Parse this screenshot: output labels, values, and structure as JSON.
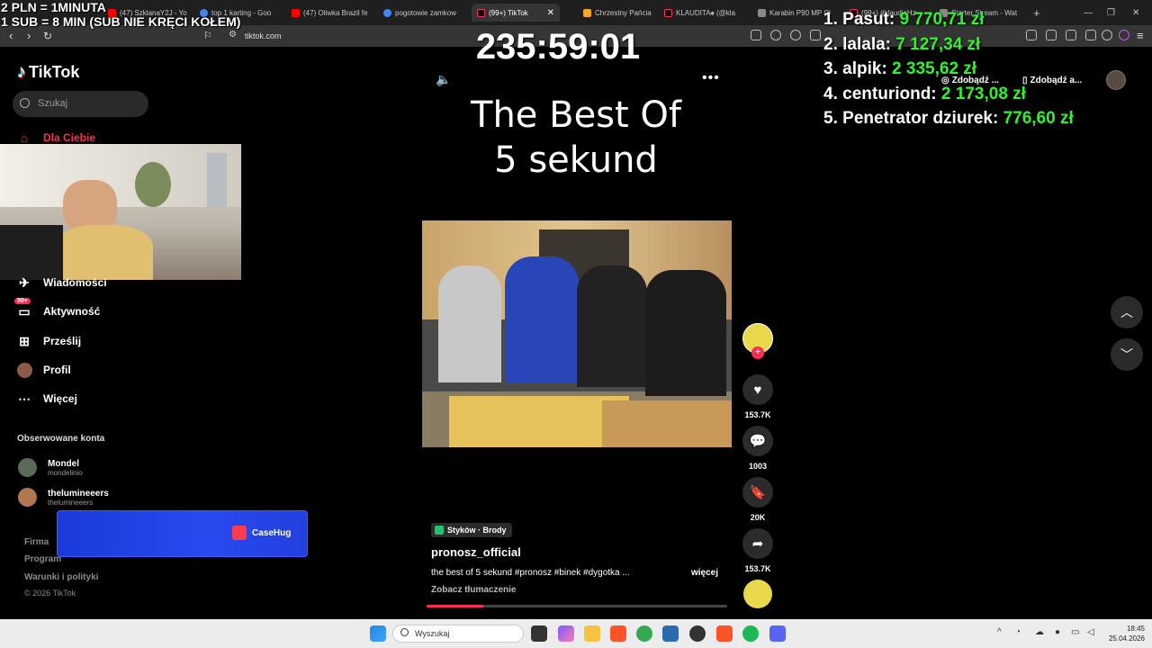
{
  "browser": {
    "tabs": [
      {
        "label": "(47) SzklanaY2J - Yo",
        "color": "#ff0000"
      },
      {
        "label": "top 1 karting - Goo",
        "color": "#4285f4"
      },
      {
        "label": "(47) Oliwka Brazil fe",
        "color": "#ff0000"
      },
      {
        "label": "pogotowie zamkow",
        "color": "#4285f4"
      },
      {
        "label": "(99+) TikTok",
        "color": "#fe2c55",
        "active": true
      },
      {
        "label": "Chrzestny Pańcia",
        "color": "#f5a623"
      },
      {
        "label": "KLAUDITA♠ (@kla",
        "color": "#fe2c55"
      },
      {
        "label": "Karabin P90 MP Ci",
        "color": "#888888"
      },
      {
        "label": "(99+) #klaudiaHz",
        "color": "#fe2c55"
      },
      {
        "label": "Starter Stream - Wat",
        "color": "#888888"
      }
    ],
    "url": "tiktok.com",
    "new_tab_label": "+"
  },
  "overlay": {
    "rate_line": "2 PLN = 1MINUTA",
    "sub_line": "1 SUB = 8 MIN (SUB NIE KRĘCI KOŁEM)",
    "timer": "235:59:01",
    "title_line1": "The Best Of",
    "title_line2": "5 sekund",
    "leaderboard": [
      {
        "rank": "1.",
        "name": "Pasut:",
        "amount": "9 770,71 zł"
      },
      {
        "rank": "2.",
        "name": "lalala:",
        "amount": "7 127,34 zł"
      },
      {
        "rank": "3.",
        "name": "alpik:",
        "amount": "2 335,62 zł"
      },
      {
        "rank": "4.",
        "name": "centuriond:",
        "amount": "2 173,08 zł"
      },
      {
        "rank": "5.",
        "name": "Penetrator dziurek:",
        "amount": "776,60 zł"
      }
    ]
  },
  "tiktok": {
    "logo": "TikTok",
    "search_placeholder": "Szukaj",
    "nav": {
      "for_you": "Dla Ciebie",
      "messages": "Wiadomości",
      "activity": "Aktywność",
      "activity_badge": "99+",
      "upload": "Prześlij",
      "profile": "Profil",
      "more": "Więcej"
    },
    "followed_title": "Obserwowane konta",
    "followed": [
      {
        "name": "Mondel",
        "handle": "mondelinio"
      },
      {
        "name": "thelumineeers",
        "handle": "thelumineeers"
      }
    ],
    "footer": {
      "company": "Firma",
      "program": "Program",
      "terms": "Warunki i polityki",
      "copyright": "© 2026 TikTok"
    },
    "get_app_1": "Zdobądź ...",
    "get_app_2": "Zdobądź a...",
    "post": {
      "location": "Styków · Brody",
      "author": "pronosz_official",
      "description": "the best of 5 sekund #pronosz #binek #dygotka ...",
      "more": "więcej",
      "translate": "Zobacz tłumaczenie",
      "likes": "153.7K",
      "comments": "1003",
      "saves": "20K",
      "shares": "153.7K",
      "progress": 0.19
    }
  },
  "casehug": {
    "brand": "CaseHug"
  },
  "taskbar": {
    "search_placeholder": "Wyszukaj",
    "time": "18:45",
    "date": "25.04.2026"
  }
}
